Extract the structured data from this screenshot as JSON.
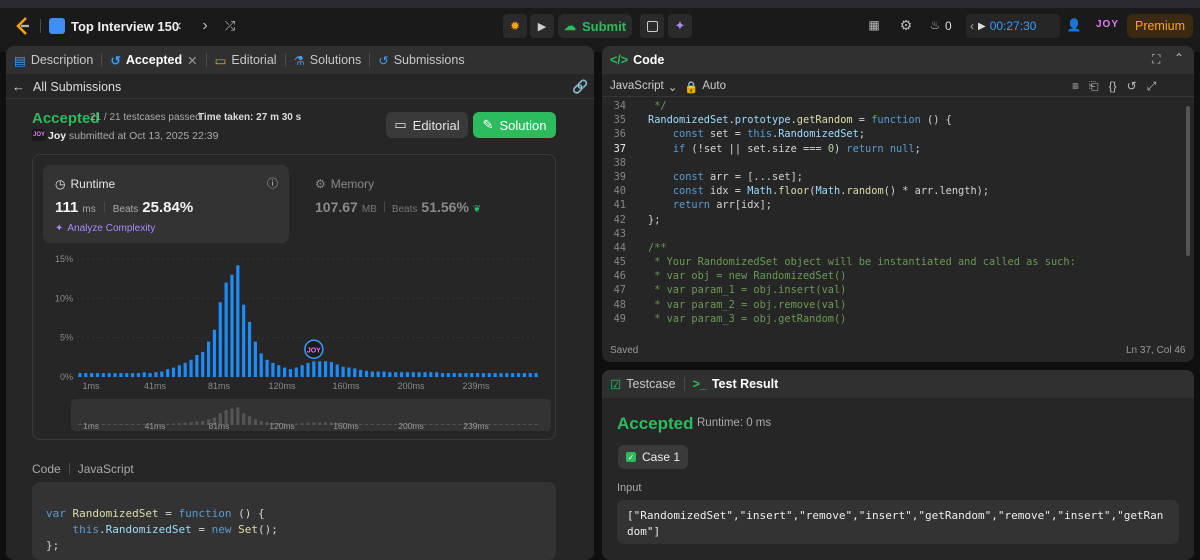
{
  "topbar": {
    "list_title": "Top Interview 150",
    "run_label": "Run",
    "submit_label": "Submit",
    "streak_count": "0",
    "timer": "00:27:30",
    "avatar_text": "JOY",
    "premium_label": "Premium"
  },
  "left_tabs": {
    "description": "Description",
    "accepted": "Accepted",
    "editorial": "Editorial",
    "solutions": "Solutions",
    "submissions": "Submissions"
  },
  "submission": {
    "back_label": "All Submissions",
    "status": "Accepted",
    "testcases": "21 / 21 testcases passed",
    "time_taken": "Time taken: 27 m 30 s",
    "user": "Joy",
    "submitted_at": "submitted at Oct 13, 2025 22:39",
    "editorial_btn": "Editorial",
    "solution_btn": "Solution"
  },
  "runtime": {
    "label": "Runtime",
    "value": "111",
    "unit": "ms",
    "beats_label": "Beats",
    "beats_value": "25.84%",
    "analyze_label": "Analyze Complexity"
  },
  "memory": {
    "label": "Memory",
    "value": "107.67",
    "unit": "MB",
    "beats_label": "Beats",
    "beats_value": "51.56%"
  },
  "chart_data": {
    "type": "bar",
    "ylim": [
      0,
      15
    ],
    "y_ticks": [
      "15%",
      "10%",
      "5%",
      "0%"
    ],
    "y_tick_values": [
      15,
      10,
      5,
      0
    ],
    "x_ticks": [
      "1ms",
      "41ms",
      "81ms",
      "120ms",
      "160ms",
      "200ms",
      "239ms"
    ],
    "values": [
      0.5,
      0.5,
      0.5,
      0.5,
      0.5,
      0.5,
      0.5,
      0.5,
      0.5,
      0.5,
      0.5,
      0.6,
      0.5,
      0.6,
      0.7,
      1.0,
      1.2,
      1.5,
      1.8,
      2.2,
      2.8,
      3.2,
      4.5,
      6.0,
      9.5,
      12.0,
      13.0,
      14.2,
      9.2,
      7.0,
      4.5,
      3.0,
      2.2,
      1.8,
      1.5,
      1.2,
      1.0,
      1.2,
      1.5,
      1.8,
      2.0,
      2.0,
      2.0,
      1.9,
      1.6,
      1.3,
      1.2,
      1.1,
      0.9,
      0.8,
      0.7,
      0.7,
      0.7,
      0.6,
      0.6,
      0.6,
      0.6,
      0.6,
      0.6,
      0.6,
      0.6,
      0.6,
      0.5,
      0.5,
      0.5,
      0.5,
      0.5,
      0.5,
      0.5,
      0.5,
      0.5,
      0.5,
      0.5,
      0.5,
      0.5,
      0.5,
      0.5,
      0.5,
      0.5
    ],
    "highlight_index": 40,
    "bar_color": "#1d8cf8",
    "avatar_label": "JOY"
  },
  "code_preview": {
    "tab_code": "Code",
    "tab_lang": "JavaScript",
    "lines": [
      "var RandomizedSet = function () {",
      "    this.RandomizedSet = new Set();",
      "};"
    ]
  },
  "editor": {
    "title": "Code",
    "language": "JavaScript",
    "mode": "Auto",
    "status": "Saved",
    "cursor": "Ln 37, Col 46",
    "line_numbers": [
      "34",
      "35",
      "36",
      "37",
      "38",
      "39",
      "40",
      "41",
      "42",
      "43",
      "44",
      "45",
      "46",
      "47",
      "48",
      "49"
    ],
    "lines": [
      " */",
      "RandomizedSet.prototype.getRandom = function () {",
      "    const set = this.RandomizedSet;",
      "    if (!set || set.size === 0) return null;",
      "",
      "    const arr = [...set];",
      "    const idx = Math.floor(Math.random() * arr.length);",
      "    return arr[idx];",
      "};",
      "",
      "/**",
      " * Your RandomizedSet object will be instantiated and called as such:",
      " * var obj = new RandomizedSet()",
      " * var param_1 = obj.insert(val)",
      " * var param_2 = obj.remove(val)",
      " * var param_3 = obj.getRandom()"
    ]
  },
  "result": {
    "tab_testcase": "Testcase",
    "tab_result": "Test Result",
    "status": "Accepted",
    "runtime": "Runtime: 0 ms",
    "case_label": "Case 1",
    "input_label": "Input",
    "input_text": "[\"RandomizedSet\",\"insert\",\"remove\",\"insert\",\"getRandom\",\"remove\",\"insert\",\"getRandom\"]"
  },
  "colors": {
    "accent_green": "#2cbb5d",
    "accent_orange": "#ffa116",
    "timer_blue": "#3b9cff"
  }
}
